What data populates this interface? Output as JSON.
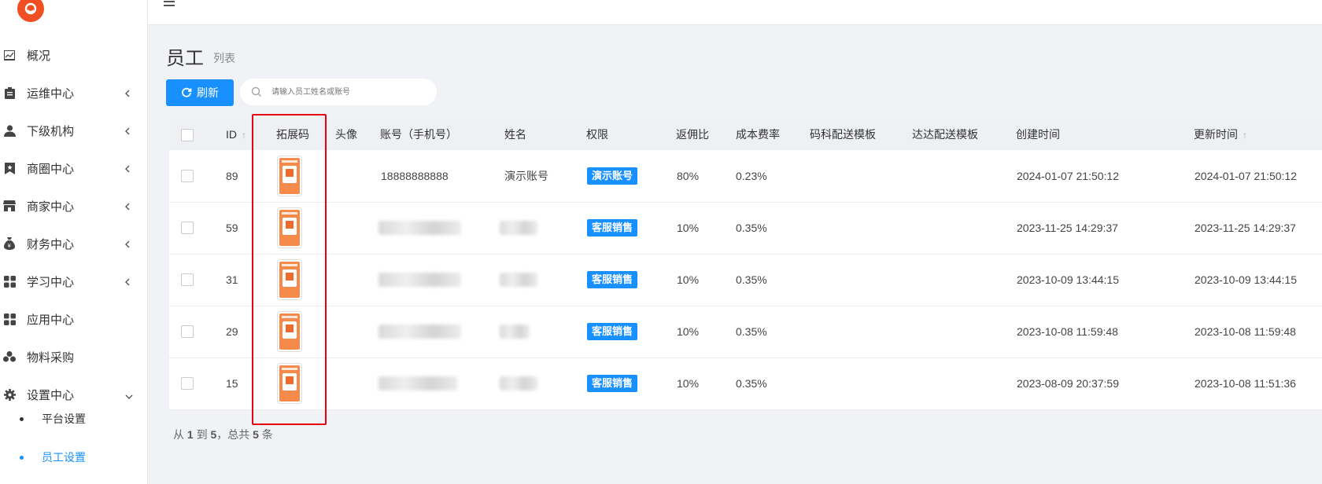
{
  "sidebar": {
    "items": [
      {
        "label": "概况",
        "icon": "chart-icon",
        "has_chevron": false
      },
      {
        "label": "运维中心",
        "icon": "clipboard-icon",
        "has_chevron": true
      },
      {
        "label": "下级机构",
        "icon": "user-icon",
        "has_chevron": true
      },
      {
        "label": "商圈中心",
        "icon": "bookmark-icon",
        "has_chevron": true
      },
      {
        "label": "商家中心",
        "icon": "store-icon",
        "has_chevron": true
      },
      {
        "label": "财务中心",
        "icon": "money-bag-icon",
        "has_chevron": true
      },
      {
        "label": "学习中心",
        "icon": "grid-icon",
        "has_chevron": true
      },
      {
        "label": "应用中心",
        "icon": "apps-icon",
        "has_chevron": false
      },
      {
        "label": "物料采购",
        "icon": "cubes-icon",
        "has_chevron": false
      },
      {
        "label": "设置中心",
        "icon": "gear-icon",
        "has_chevron": true
      }
    ],
    "sub_items": [
      {
        "label": "平台设置",
        "active": false
      },
      {
        "label": "员工设置",
        "active": true
      }
    ]
  },
  "page": {
    "title": "员工",
    "subtitle": "列表"
  },
  "toolbar": {
    "refresh_label": "刷新",
    "search_placeholder": "请输入员工姓名或账号"
  },
  "table": {
    "headers": {
      "id": "ID",
      "qr": "拓展码",
      "avatar": "头像",
      "account": "账号（手机号）",
      "name": "姓名",
      "role": "权限",
      "commission": "返佣比",
      "fee_rate": "成本费率",
      "mk_template": "码科配送模板",
      "dd_template": "达达配送模板",
      "created": "创建时间",
      "updated": "更新时间"
    },
    "rows": [
      {
        "id": "89",
        "account": "18888888888",
        "name": "演示账号",
        "role": "演示账号",
        "commission": "80%",
        "fee_rate": "0.23%",
        "created": "2024-01-07 21:50:12",
        "updated": "2024-01-07 21:50:12"
      },
      {
        "id": "59",
        "account": "",
        "name": "",
        "role": "客服销售",
        "commission": "10%",
        "fee_rate": "0.35%",
        "created": "2023-11-25 14:29:37",
        "updated": "2023-11-25 14:29:37"
      },
      {
        "id": "31",
        "account": "",
        "name": "",
        "role": "客服销售",
        "commission": "10%",
        "fee_rate": "0.35%",
        "created": "2023-10-09 13:44:15",
        "updated": "2023-10-09 13:44:15"
      },
      {
        "id": "29",
        "account": "",
        "name": "",
        "role": "客服销售",
        "commission": "10%",
        "fee_rate": "0.35%",
        "created": "2023-10-08 11:59:48",
        "updated": "2023-10-08 11:59:48"
      },
      {
        "id": "15",
        "account": "",
        "name": "",
        "role": "客服销售",
        "commission": "10%",
        "fee_rate": "0.35%",
        "created": "2023-08-09 20:37:59",
        "updated": "2023-10-08 11:51:36"
      }
    ]
  },
  "pagination": {
    "prefix": "从",
    "from": "1",
    "to_word": "到",
    "to": "5",
    "total_word": "，总共",
    "total": "5",
    "suffix": "条"
  },
  "colors": {
    "accent": "#1890ff",
    "highlight_box": "#e60012",
    "logo": "#f04e23"
  }
}
